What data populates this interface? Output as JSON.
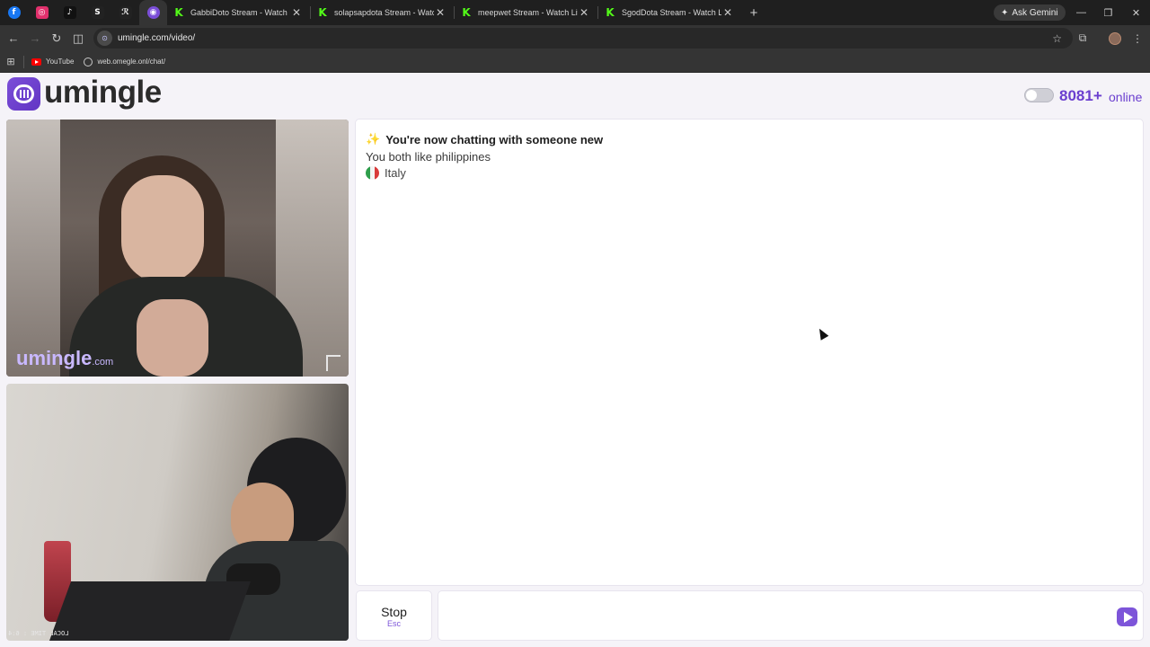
{
  "browser": {
    "pinned_tabs": [
      {
        "icon": "facebook-icon",
        "glyph": "f",
        "color": "#1877f2"
      },
      {
        "icon": "instagram-icon",
        "glyph": "◎",
        "color": "#e1306c"
      },
      {
        "icon": "tiktok-icon",
        "glyph": "♪",
        "color": "#111111"
      },
      {
        "icon": "s-app-icon",
        "glyph": "S",
        "color": "#222222"
      },
      {
        "icon": "app-icon",
        "glyph": "ℛ",
        "color": "#222222"
      },
      {
        "icon": "umingle-tab-icon",
        "glyph": "◉",
        "color": "#7b4ed8"
      }
    ],
    "tabs": [
      {
        "title": "GabbiDoto Stream - Watch Live"
      },
      {
        "title": "solapsapdota Stream - Watch L"
      },
      {
        "title": "meepwet Stream - Watch Live o"
      },
      {
        "title": "SgodDota Stream - Watch Live"
      }
    ],
    "new_tab": "+",
    "ask_gemini": "Ask Gemini",
    "url": "umingle.com/video/",
    "bookmarks": [
      {
        "label": "YouTube"
      },
      {
        "label": "web.omegle.onl/chat/"
      }
    ]
  },
  "site": {
    "logo": "umingle",
    "online_count": "8081+",
    "online_label": "online"
  },
  "video": {
    "watermark": "umingle",
    "watermark_suffix": ".com",
    "self_overlay": "LOCAL TIME : 6:4"
  },
  "chat": {
    "title": "You're now chatting with someone new",
    "sparkle": "✨",
    "common": "You both like philippines",
    "country": "Italy"
  },
  "controls": {
    "stop_label": "Stop",
    "stop_key": "Esc",
    "message_placeholder": ""
  },
  "colors": {
    "accent": "#6b3fcf",
    "kick_green": "#53fc18"
  }
}
